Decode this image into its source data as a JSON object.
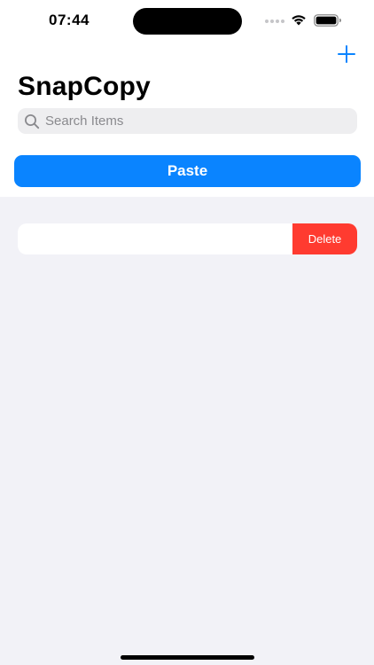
{
  "status_bar": {
    "time": "07:44"
  },
  "nav": {
    "title": "SnapCopy",
    "add_icon": "plus-icon"
  },
  "search": {
    "placeholder": "Search Items",
    "value": "",
    "icon": "magnifying-glass-icon"
  },
  "actions": {
    "paste_label": "Paste"
  },
  "items": [
    {
      "text": "",
      "delete_label": "Delete"
    }
  ],
  "colors": {
    "accent": "#0a84ff",
    "destructive": "#ff3b30",
    "background": "#f2f2f7"
  }
}
